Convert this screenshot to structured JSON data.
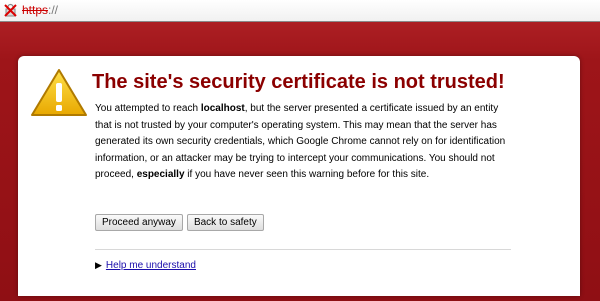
{
  "omnibox": {
    "scheme": "https",
    "rest": "://",
    "icon": "broken-lock-x-icon"
  },
  "warning": {
    "icon": "warning-triangle-icon",
    "title": "The site's security certificate is not trusted!",
    "body": [
      {
        "text": "You attempted to reach ",
        "bold": false
      },
      {
        "text": "localhost",
        "bold": true
      },
      {
        "text": ", but the server presented a certificate issued by an entity that is not trusted by your computer's operating system. This may mean that the server has generated its own security credentials, which Google Chrome cannot rely on for identification information, or an attacker may be trying to intercept your communications. You should not proceed, ",
        "bold": false
      },
      {
        "text": "especially",
        "bold": true
      },
      {
        "text": " if you have never seen this warning before for this site.",
        "bold": false
      }
    ]
  },
  "buttons": {
    "proceed": "Proceed anyway",
    "back": "Back to safety"
  },
  "help": {
    "arrow": "▶",
    "label": "Help me understand"
  },
  "colors": {
    "background": "#9e1519",
    "title": "#8b0000",
    "link": "#1a0dab",
    "warning_yellow": "#f5c400"
  }
}
